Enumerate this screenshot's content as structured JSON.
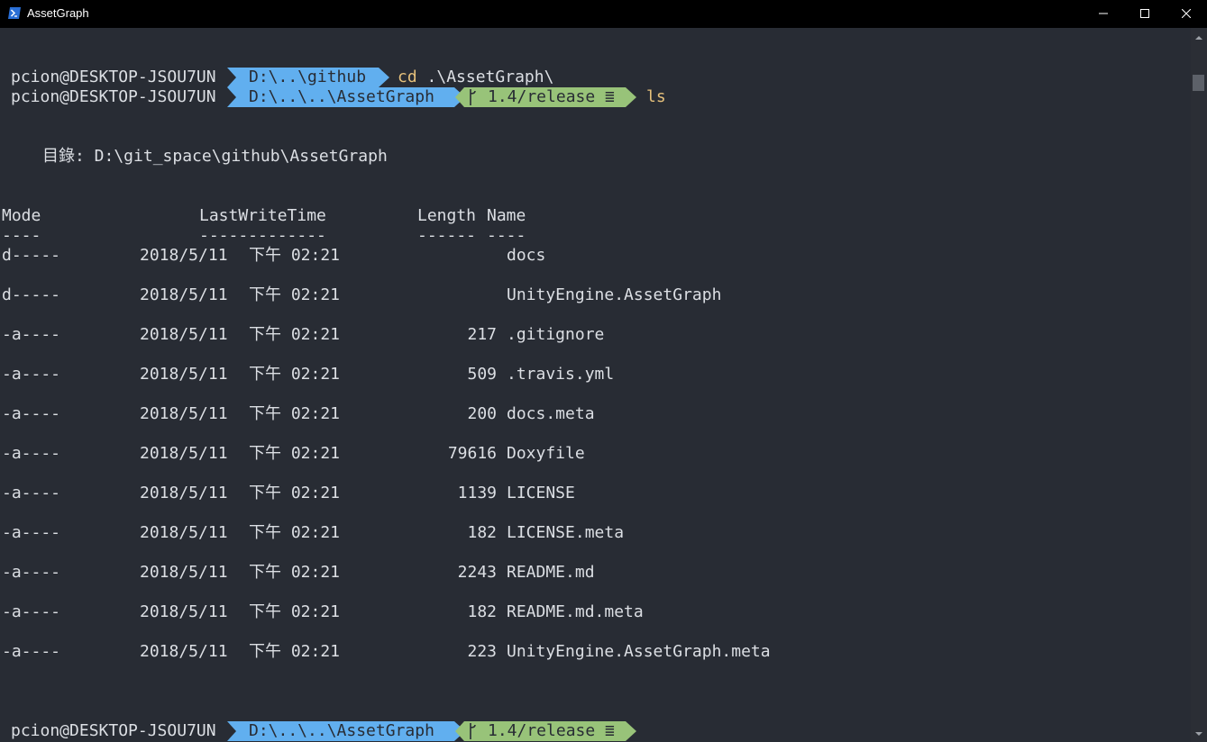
{
  "window": {
    "title": "AssetGraph",
    "controls": [
      "minimize",
      "maximize",
      "close"
    ]
  },
  "prompts": [
    {
      "user": "pcion@DESKTOP-JSOU7UN",
      "path": "D:\\..\\github",
      "branch": "",
      "command": "cd",
      "args": ".\\AssetGraph\\"
    },
    {
      "user": "pcion@DESKTOP-JSOU7UN",
      "path": "D:\\..\\..\\AssetGraph",
      "branch": "1.4/release ≣",
      "command": "ls",
      "args": ""
    },
    {
      "user": "pcion@DESKTOP-JSOU7UN",
      "path": "D:\\..\\..\\AssetGraph",
      "branch": "1.4/release ≣",
      "command": "",
      "args": ""
    }
  ],
  "listing": {
    "directory_label": "目錄: D:\\git_space\\github\\AssetGraph",
    "headers": {
      "mode": "Mode",
      "lastwrite": "LastWriteTime",
      "length": "Length",
      "name": "Name"
    },
    "underlines": {
      "mode": "----",
      "lastwrite": "-------------",
      "length": "------",
      "name": "----"
    },
    "rows": [
      {
        "mode": "d-----",
        "date": "2018/5/11",
        "time": "下午 02:21",
        "length": "",
        "name": "docs"
      },
      {
        "mode": "d-----",
        "date": "2018/5/11",
        "time": "下午 02:21",
        "length": "",
        "name": "UnityEngine.AssetGraph"
      },
      {
        "mode": "-a----",
        "date": "2018/5/11",
        "time": "下午 02:21",
        "length": "217",
        "name": ".gitignore"
      },
      {
        "mode": "-a----",
        "date": "2018/5/11",
        "time": "下午 02:21",
        "length": "509",
        "name": ".travis.yml"
      },
      {
        "mode": "-a----",
        "date": "2018/5/11",
        "time": "下午 02:21",
        "length": "200",
        "name": "docs.meta"
      },
      {
        "mode": "-a----",
        "date": "2018/5/11",
        "time": "下午 02:21",
        "length": "79616",
        "name": "Doxyfile"
      },
      {
        "mode": "-a----",
        "date": "2018/5/11",
        "time": "下午 02:21",
        "length": "1139",
        "name": "LICENSE"
      },
      {
        "mode": "-a----",
        "date": "2018/5/11",
        "time": "下午 02:21",
        "length": "182",
        "name": "LICENSE.meta"
      },
      {
        "mode": "-a----",
        "date": "2018/5/11",
        "time": "下午 02:21",
        "length": "2243",
        "name": "README.md"
      },
      {
        "mode": "-a----",
        "date": "2018/5/11",
        "time": "下午 02:21",
        "length": "182",
        "name": "README.md.meta"
      },
      {
        "mode": "-a----",
        "date": "2018/5/11",
        "time": "下午 02:21",
        "length": "223",
        "name": "UnityEngine.AssetGraph.meta"
      }
    ]
  },
  "colors": {
    "background": "#282c34",
    "path_segment": "#61afef",
    "git_segment": "#98c379",
    "command_keyword": "#e5c07b",
    "text": "#dcdfe4"
  }
}
